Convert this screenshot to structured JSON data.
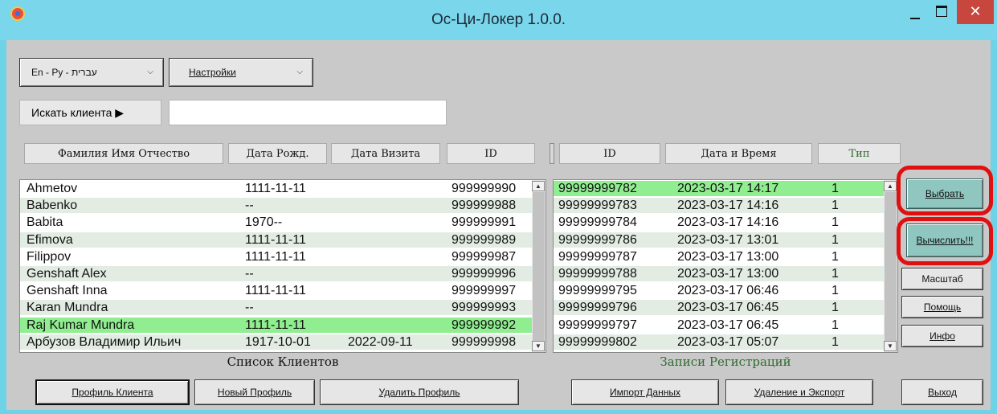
{
  "window": {
    "title": "Ос-Ци-Локер 1.0.0.",
    "close_glyph": "✕"
  },
  "toolbar": {
    "language_label": "En - Ру - עברית",
    "language_underline": "E",
    "settings_label": "Настройки",
    "settings_underline": "Н"
  },
  "search": {
    "button_label": "Искать клиента ▶",
    "value": "",
    "placeholder": ""
  },
  "clients": {
    "headers": [
      "Фамилия Имя Отчество",
      "Дата Рожд.",
      "Дата Визита",
      "ID"
    ],
    "selected_index": 8,
    "rows": [
      [
        "Ahmetov",
        "1111-11-11",
        "",
        "999999990"
      ],
      [
        "Babenko",
        "--",
        "",
        "999999988"
      ],
      [
        "Babita",
        "1970--",
        "",
        "999999991"
      ],
      [
        "Efimova",
        "1111-11-11",
        "",
        "999999989"
      ],
      [
        "Filippov",
        "1111-11-11",
        "",
        "999999987"
      ],
      [
        "Genshaft Alex",
        "--",
        "",
        "999999996"
      ],
      [
        "Genshaft Inna",
        "1111-11-11",
        "",
        "999999997"
      ],
      [
        "Karan Mundra",
        "--",
        "",
        "999999993"
      ],
      [
        "Raj Kumar Mundra",
        "1111-11-11",
        "",
        "999999992"
      ],
      [
        "Арбузов Владимир Ильич",
        "1917-10-01",
        "2022-09-11",
        "999999998"
      ]
    ],
    "caption": "Список Клиентов"
  },
  "registrations": {
    "headers": [
      "ID",
      "Дата и Время",
      "Тип"
    ],
    "selected_index": 0,
    "rows": [
      [
        "99999999782",
        "2023-03-17 14:17",
        "1"
      ],
      [
        "99999999783",
        "2023-03-17 14:16",
        "1"
      ],
      [
        "99999999784",
        "2023-03-17 14:16",
        "1"
      ],
      [
        "99999999786",
        "2023-03-17 13:01",
        "1"
      ],
      [
        "99999999787",
        "2023-03-17 13:00",
        "1"
      ],
      [
        "99999999788",
        "2023-03-17 13:00",
        "1"
      ],
      [
        "99999999795",
        "2023-03-17 06:46",
        "1"
      ],
      [
        "99999999796",
        "2023-03-17 06:45",
        "1"
      ],
      [
        "99999999797",
        "2023-03-17 06:45",
        "1"
      ],
      [
        "99999999802",
        "2023-03-17 05:07",
        "1"
      ]
    ],
    "caption": "Записи Регистраций"
  },
  "side_buttons": {
    "select": "Выбрать",
    "calculate": "Вычислить!!!",
    "scale": "Масштаб",
    "help": "Помощь",
    "info": "Инфо"
  },
  "bottom_buttons": {
    "client_profile": "Профиль Клиента",
    "new_profile": "Новый Профиль",
    "delete_profile": "Удалить Профиль",
    "import_data": "Импорт Данных",
    "delete_export": "Удаление и Экспорт",
    "exit": "Выход"
  },
  "colors": {
    "selected_row": "#90ee90",
    "alt_row": "#e3ece3",
    "highlight_ring": "#e01010",
    "green_button": "#8fc7c0"
  }
}
